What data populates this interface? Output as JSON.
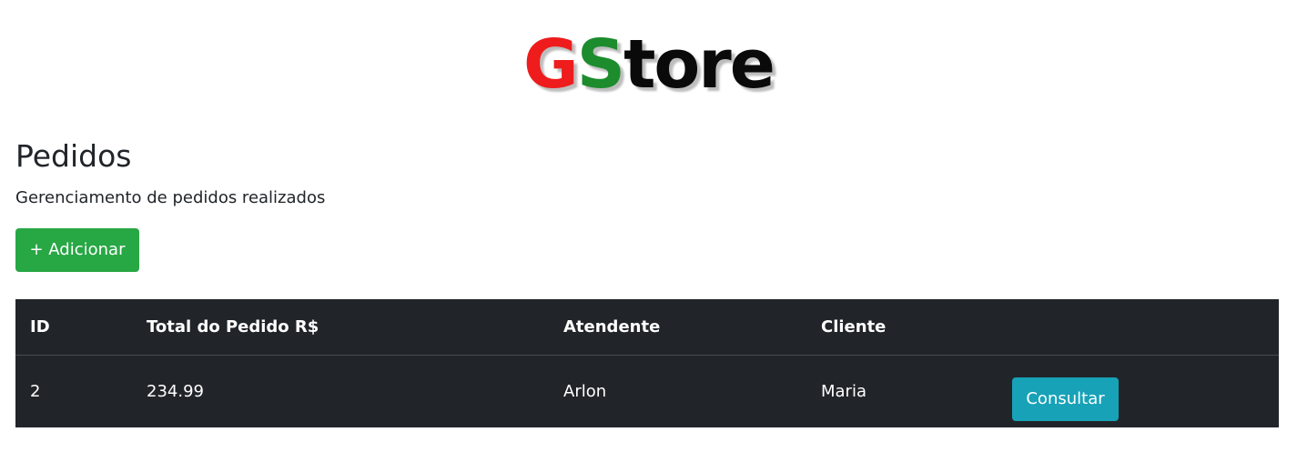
{
  "logo": {
    "letter_g": "G",
    "letter_s": "S",
    "rest": "tore",
    "colors": {
      "g": "#ee1c1c",
      "s": "#1c8c2c",
      "rest": "#0a0a0a"
    }
  },
  "page": {
    "title": "Pedidos",
    "subtitle": "Gerenciamento de pedidos realizados"
  },
  "actions": {
    "add_label": "+ Adicionar"
  },
  "table": {
    "headers": {
      "id": "ID",
      "total": "Total do Pedido R$",
      "atendente": "Atendente",
      "cliente": "Cliente"
    },
    "rows": [
      {
        "id": "2",
        "total": "234.99",
        "atendente": "Arlon",
        "cliente": "Maria",
        "action_label": "Consultar"
      }
    ]
  },
  "colors": {
    "success": "#28a745",
    "info": "#17a2b8",
    "table_dark": "#212529"
  }
}
